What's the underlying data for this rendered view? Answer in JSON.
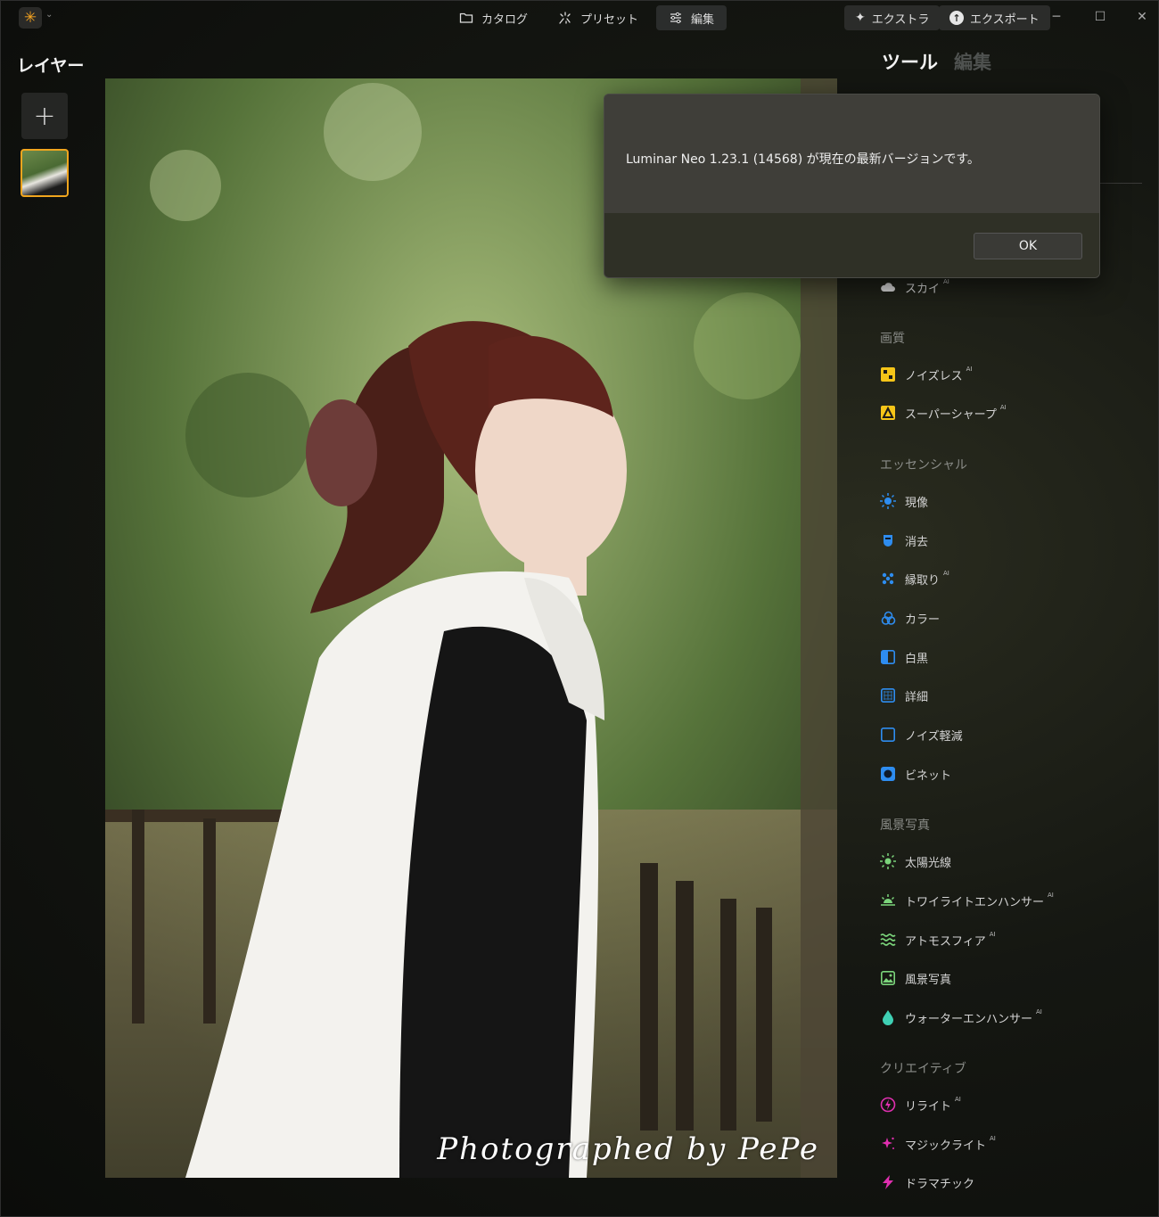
{
  "titlebar": {
    "tabs": [
      {
        "label": "カタログ",
        "icon": "folder-icon"
      },
      {
        "label": "プリセット",
        "icon": "sparkle-icon"
      },
      {
        "label": "編集",
        "icon": "sliders-icon",
        "active": true
      }
    ],
    "extras_label": "エクストラ",
    "export_label": "エクスポート"
  },
  "layers": {
    "title": "レイヤー"
  },
  "photo": {
    "watermark": "Photographed by PePe"
  },
  "panel": {
    "tab_tools": "ツール",
    "tab_edit": "編集",
    "sky_item": {
      "label": "スカイ",
      "ai": "AI"
    },
    "sections": {
      "quality": "画質",
      "essentials": "エッセンシャル",
      "landscape": "風景写真",
      "creative": "クリエイティブ"
    },
    "quality_items": [
      {
        "label": "ノイズレス",
        "ai": "AI"
      },
      {
        "label": "スーパーシャープ",
        "ai": "AI"
      }
    ],
    "essential_items": [
      {
        "label": "現像"
      },
      {
        "label": "消去"
      },
      {
        "label": "縁取り",
        "ai": "AI"
      },
      {
        "label": "カラー"
      },
      {
        "label": "白黒"
      },
      {
        "label": "詳細"
      },
      {
        "label": "ノイズ軽減"
      },
      {
        "label": "ビネット"
      }
    ],
    "landscape_items": [
      {
        "label": "太陽光線"
      },
      {
        "label": "トワイライトエンハンサー",
        "ai": "AI"
      },
      {
        "label": "アトモスフィア",
        "ai": "AI"
      },
      {
        "label": "風景写真"
      },
      {
        "label": "ウォーターエンハンサー",
        "ai": "AI"
      }
    ],
    "creative_items": [
      {
        "label": "リライト",
        "ai": "AI"
      },
      {
        "label": "マジックライト",
        "ai": "AI"
      },
      {
        "label": "ドラマチック"
      }
    ]
  },
  "dialog": {
    "message": "Luminar Neo 1.23.1 (14568) が現在の最新バージョンです。",
    "ok_label": "OK"
  },
  "colors": {
    "accent": "#f0a51e",
    "tool_blue": "#2e8df0",
    "tool_yellow": "#f5c518",
    "tool_green": "#7bd47b",
    "tool_magenta": "#e02fb0"
  }
}
